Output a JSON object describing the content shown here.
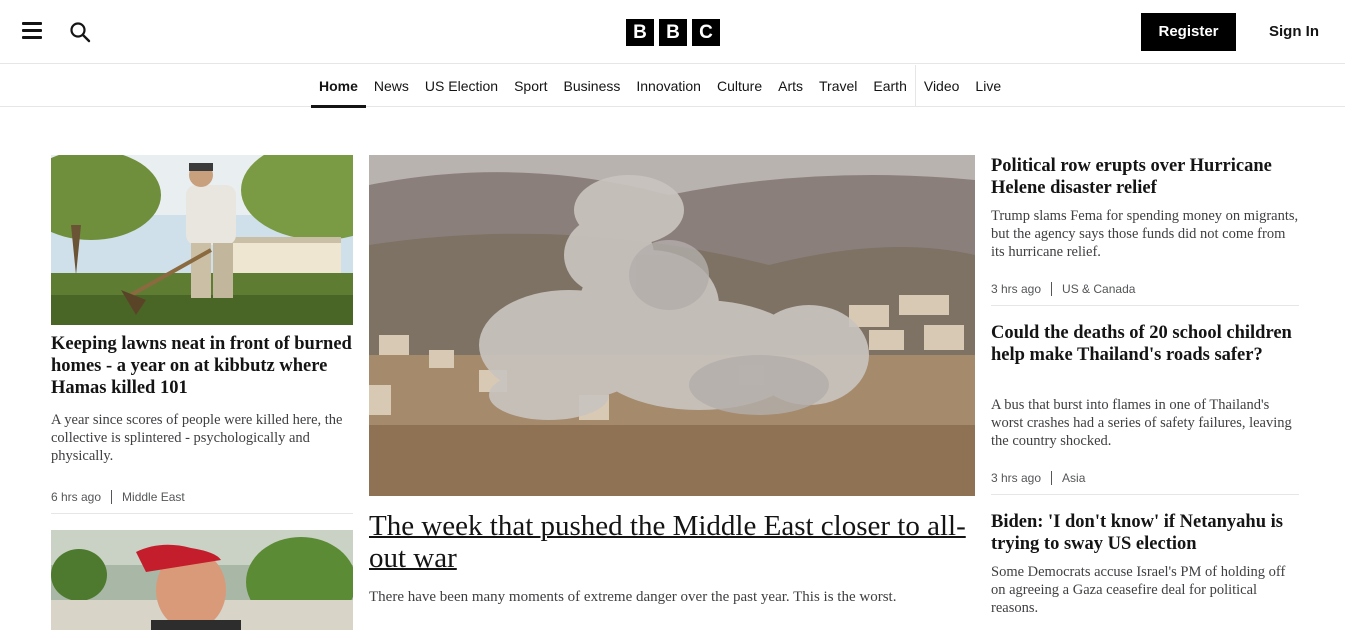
{
  "header": {
    "logo_letters": [
      "B",
      "B",
      "C"
    ],
    "register_label": "Register",
    "signin_label": "Sign In"
  },
  "nav": {
    "items": [
      {
        "label": "Home",
        "active": true
      },
      {
        "label": "News"
      },
      {
        "label": "US Election"
      },
      {
        "label": "Sport"
      },
      {
        "label": "Business"
      },
      {
        "label": "Innovation"
      },
      {
        "label": "Culture"
      },
      {
        "label": "Arts"
      },
      {
        "label": "Travel"
      },
      {
        "label": "Earth"
      },
      {
        "label": "Video"
      },
      {
        "label": "Live"
      }
    ]
  },
  "left_stories": [
    {
      "headline": "Keeping lawns neat in front of burned homes - a year on at kibbutz where Hamas killed 101",
      "summary": "A year since scores of people were killed here, the collective is splintered - psychologically and physically.",
      "time": "6 hrs ago",
      "tag": "Middle East"
    }
  ],
  "lead_story": {
    "headline": "The week that pushed the Middle East closer to all-out war",
    "summary": "There have been many moments of extreme danger over the past year. This is the worst."
  },
  "right_stories": [
    {
      "headline": "Political row erupts over Hurricane Helene disaster relief",
      "summary": "Trump slams Fema for spending money on migrants, but the agency says those funds did not come from its hurricane relief.",
      "time": "3 hrs ago",
      "tag": "US & Canada"
    },
    {
      "headline": "Could the deaths of 20 school children help make Thailand's roads safer?",
      "summary": "A bus that burst into flames in one of Thailand's worst crashes had a series of safety failures, leaving the country shocked.",
      "time": "3 hrs ago",
      "tag": "Asia"
    },
    {
      "headline": "Biden: 'I don't know' if Netanyahu is trying to sway US election",
      "summary": "Some Democrats accuse Israel's PM of holding off on agreeing a Gaza ceasefire deal for political reasons."
    }
  ]
}
